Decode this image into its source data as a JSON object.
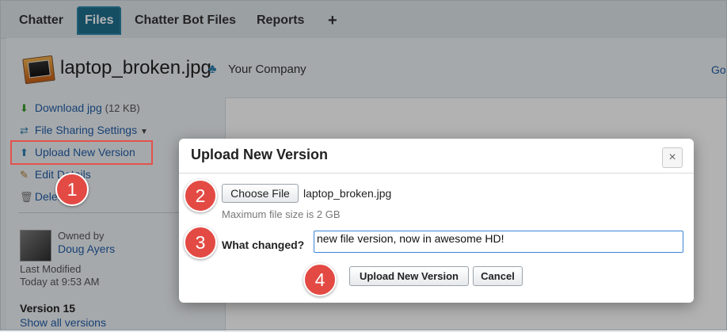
{
  "tabs": [
    {
      "label": "Chatter"
    },
    {
      "label": "Files"
    },
    {
      "label": "Chatter Bot Files"
    },
    {
      "label": "Reports"
    },
    {
      "label": "+"
    }
  ],
  "header": {
    "filename": "laptop_broken.jpg",
    "company": "Your Company",
    "go_link": "Go"
  },
  "sidebar": {
    "download_label": "Download jpg",
    "download_size": "(12 KB)",
    "sharing_label": "File Sharing Settings",
    "upload_label": "Upload New Version",
    "edit_label": "Edit Details",
    "delete_label": "Delete",
    "owned_by_label": "Owned by",
    "owner_name": "Doug Ayers",
    "last_modified_label": "Last Modified",
    "last_modified_value": "Today at 9:53 AM",
    "version_label": "Version 15",
    "show_versions_label": "Show all versions"
  },
  "modal": {
    "title": "Upload New Version",
    "close_symbol": "×",
    "choose_file_label": "Choose File",
    "chosen_file": "laptop_broken.jpg",
    "max_size_hint": "Maximum file size is 2 GB",
    "what_changed_label": "What changed?",
    "what_changed_value": "new file version, now in awesome HD!",
    "upload_button": "Upload New Version",
    "cancel_button": "Cancel"
  },
  "steps": [
    "1",
    "2",
    "3",
    "4"
  ],
  "colors": {
    "tab_active": "#1f6f8f",
    "link": "#225ea8",
    "highlight": "#e3524b",
    "step_badge": "#e34a44"
  }
}
